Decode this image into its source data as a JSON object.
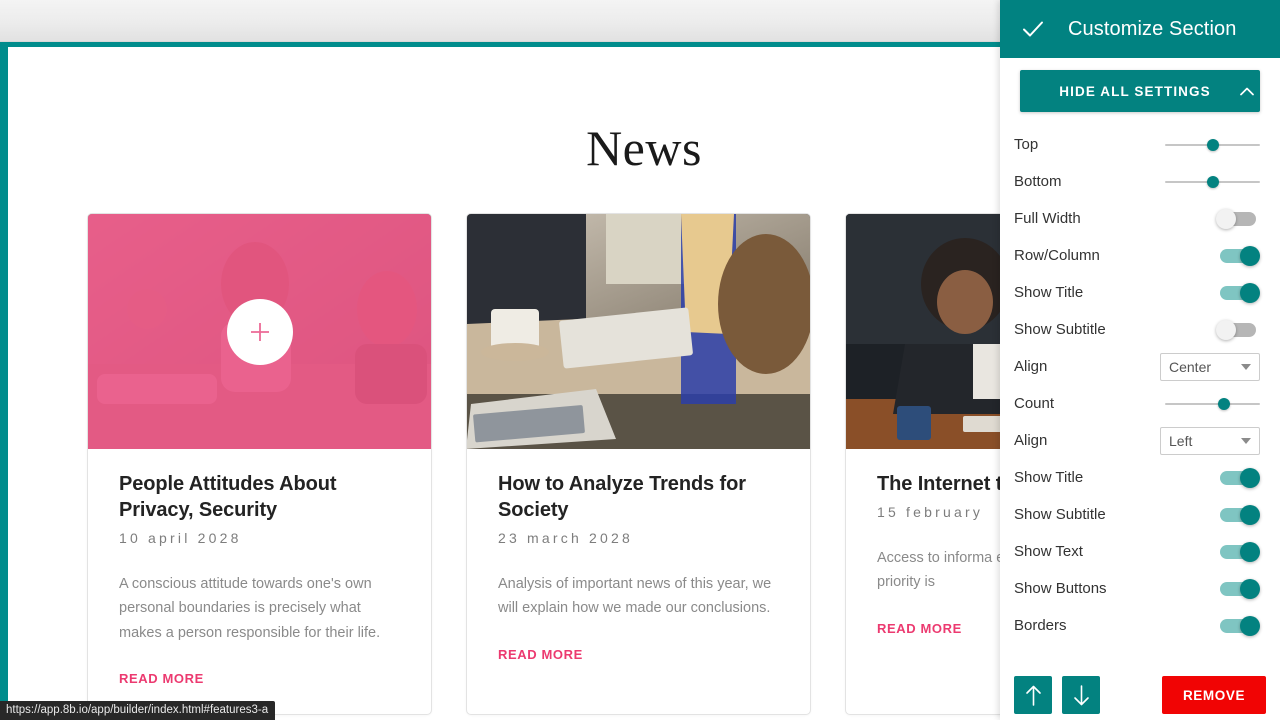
{
  "browser": {
    "status_url": "https://app.8b.io/app/builder/index.html#features3-a"
  },
  "canvas": {
    "section_title": "News",
    "cards": [
      {
        "title": "People Attitudes About Privacy, Security",
        "date": "10 april 2028",
        "text": "A conscious attitude towards one's own personal boundaries is precisely what makes a person responsible for their life.",
        "link": "READ MORE",
        "media_alt": "women working together at a desk",
        "overlay": true,
        "plus_icon": "plus-icon"
      },
      {
        "title": "How to Analyze Trends for Society",
        "date": "23 march 2028",
        "text": "Analysis of important news of this year, we will explain how we made our conclusions.",
        "link": "READ MORE",
        "media_alt": "people at a table with laptop, coffee mug and notebook",
        "overlay": false
      },
      {
        "title": "The Internet to Everyone",
        "date": "15 february",
        "text": "Access to informa earlier people hel today's priority is",
        "link": "READ MORE",
        "media_alt": "two women looking at a laptop in an office",
        "overlay": false
      }
    ]
  },
  "panel": {
    "title": "Customize Section",
    "check_icon": "check-icon",
    "hide_all_label": "HIDE ALL SETTINGS",
    "hide_all_icon": "chevron-up-icon",
    "colors": {
      "teal": "#018281",
      "teal_button": "#038280",
      "toggle_on_track": "#7fc5c2",
      "toggle_off_track": "#b6b6b6",
      "remove_red": "#f10404",
      "accent_pink": "#ec3a70"
    },
    "settings": [
      {
        "label": "Top",
        "control": "slider",
        "value": 50
      },
      {
        "label": "Bottom",
        "control": "slider",
        "value": 50
      },
      {
        "label": "Full Width",
        "control": "toggle",
        "value": false
      },
      {
        "label": "Row/Column",
        "control": "toggle",
        "value": true
      },
      {
        "label": "Show Title",
        "control": "toggle",
        "value": true
      },
      {
        "label": "Show Subtitle",
        "control": "toggle",
        "value": false
      },
      {
        "label": "Align",
        "control": "select",
        "value": "Center"
      },
      {
        "label": "Count",
        "control": "slider",
        "value": 62
      },
      {
        "label": "Align",
        "control": "select",
        "value": "Left"
      },
      {
        "label": "Show Title",
        "control": "toggle",
        "value": true
      },
      {
        "label": "Show Subtitle",
        "control": "toggle",
        "value": true
      },
      {
        "label": "Show Text",
        "control": "toggle",
        "value": true
      },
      {
        "label": "Show  Buttons",
        "control": "toggle",
        "value": true
      },
      {
        "label": "Borders",
        "control": "toggle",
        "value": true
      }
    ],
    "actions": {
      "move_up_icon": "arrow-up-icon",
      "move_down_icon": "arrow-down-icon",
      "remove_label": "REMOVE"
    }
  }
}
